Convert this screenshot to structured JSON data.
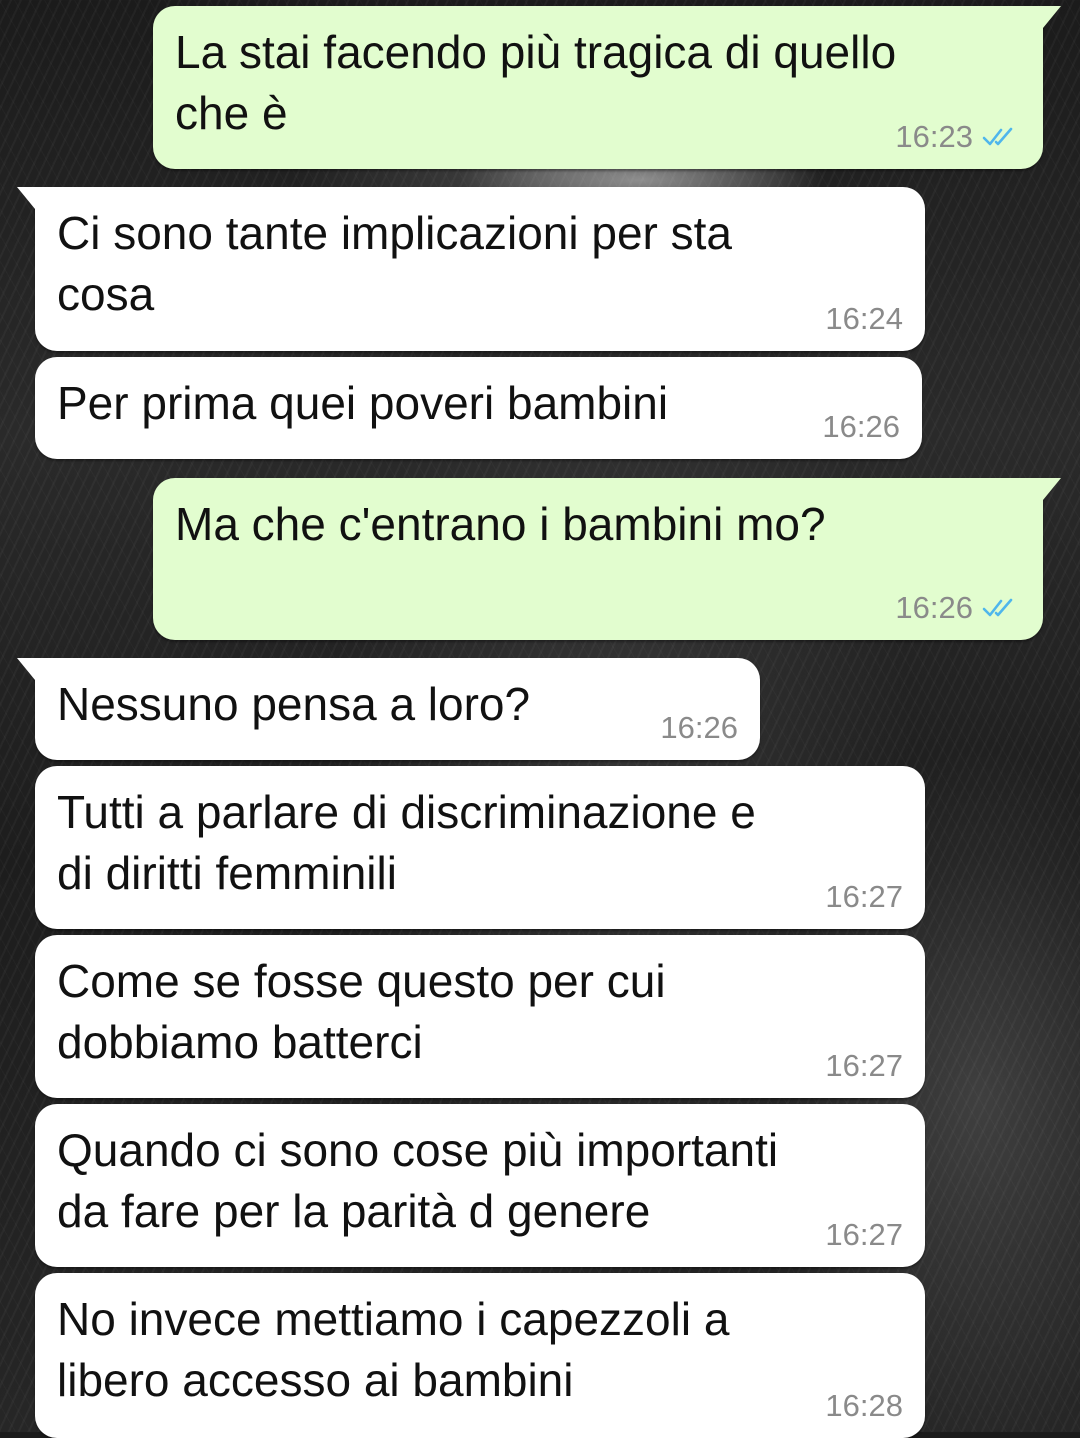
{
  "chat": {
    "messages": [
      {
        "direction": "out",
        "text": "La stai facendo più tragica di quello\nche è",
        "time": "16:23",
        "status": "read-ticks-icon"
      },
      {
        "direction": "in",
        "text": "Ci sono tante implicazioni per sta\ncosa",
        "time": "16:24"
      },
      {
        "direction": "in",
        "text": "Per prima quei poveri bambini",
        "time": "16:26"
      },
      {
        "direction": "out",
        "text": "Ma che c'entrano i bambini mo?",
        "time": "16:26",
        "status": "read-ticks-icon"
      },
      {
        "direction": "in",
        "text": "Nessuno pensa a loro?",
        "time": "16:26"
      },
      {
        "direction": "in",
        "text": "Tutti a parlare di discriminazione e\ndi diritti femminili",
        "time": "16:27"
      },
      {
        "direction": "in",
        "text": "Come se fosse questo per cui\ndobbiamo batterci",
        "time": "16:27"
      },
      {
        "direction": "in",
        "text": "Quando ci sono cose più importanti\nda fare per la parità d genere",
        "time": "16:27"
      },
      {
        "direction": "in",
        "text": "No invece mettiamo i capezzoli a\nlibero accesso ai bambini",
        "time": "16:28"
      }
    ]
  },
  "colors": {
    "outgoing_bubble": "#e2fdcf",
    "incoming_bubble": "#ffffff",
    "read_ticks": "#4fb6ec",
    "timestamp": "#8a8a8a"
  }
}
